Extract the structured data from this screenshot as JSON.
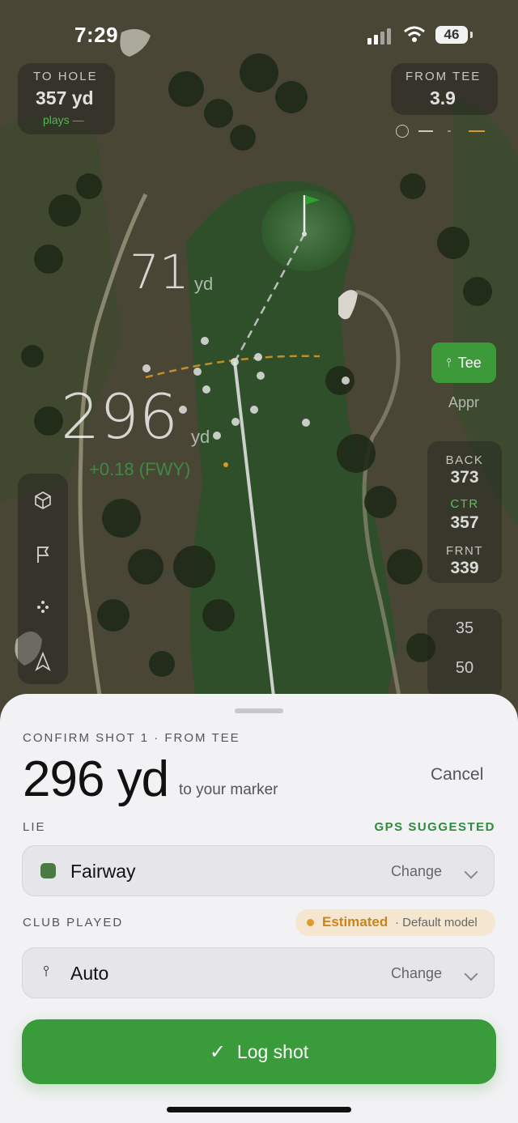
{
  "status": {
    "time": "7:29",
    "battery": "46"
  },
  "hud": {
    "to_hole_label": "TO HOLE",
    "to_hole_value": "357 yd",
    "plays": "plays —",
    "from_tee_label": "FROM TEE",
    "from_tee_value": "3.9"
  },
  "map": {
    "dist_to_pin": "71",
    "dist_to_pin_unit": "yd",
    "dist_from_tee": "296",
    "dist_from_tee_unit": "yd",
    "strokes_gained": "+0.18 (FWY)"
  },
  "right_rail": {
    "tee_label": "Tee",
    "appr_label": "Appr",
    "back_label": "BACK",
    "back_value": "373",
    "ctr_label": "CTR",
    "ctr_value": "357",
    "front_label": "FRNT",
    "front_value": "339",
    "marks": [
      "35",
      "50"
    ]
  },
  "sheet": {
    "title": "CONFIRM SHOT 1 · FROM TEE",
    "distance": "296 yd",
    "distance_sub": "to your marker",
    "cancel": "Cancel",
    "lie_label": "LIE",
    "gps_suggested": "GPS SUGGESTED",
    "lie_value": "Fairway",
    "lie_change": "Change",
    "club_label": "CLUB PLAYED",
    "estimated": "Estimated",
    "default_model": "· Default model",
    "club_value": "Auto",
    "club_change": "Change",
    "log_shot": "Log shot"
  },
  "icons": [
    "signal-icon",
    "wifi-icon",
    "battery-icon",
    "compass-icon",
    "cube-icon",
    "flag-icon",
    "dispersion-icon",
    "navigate-icon",
    "tee-icon",
    "chevron-down-icon",
    "check-icon"
  ],
  "colors": {
    "accent_green": "#3a9b3a",
    "estimated_orange": "#e09a2e",
    "gps_green": "#2e8b3d",
    "fairway": "#4a7a43"
  }
}
